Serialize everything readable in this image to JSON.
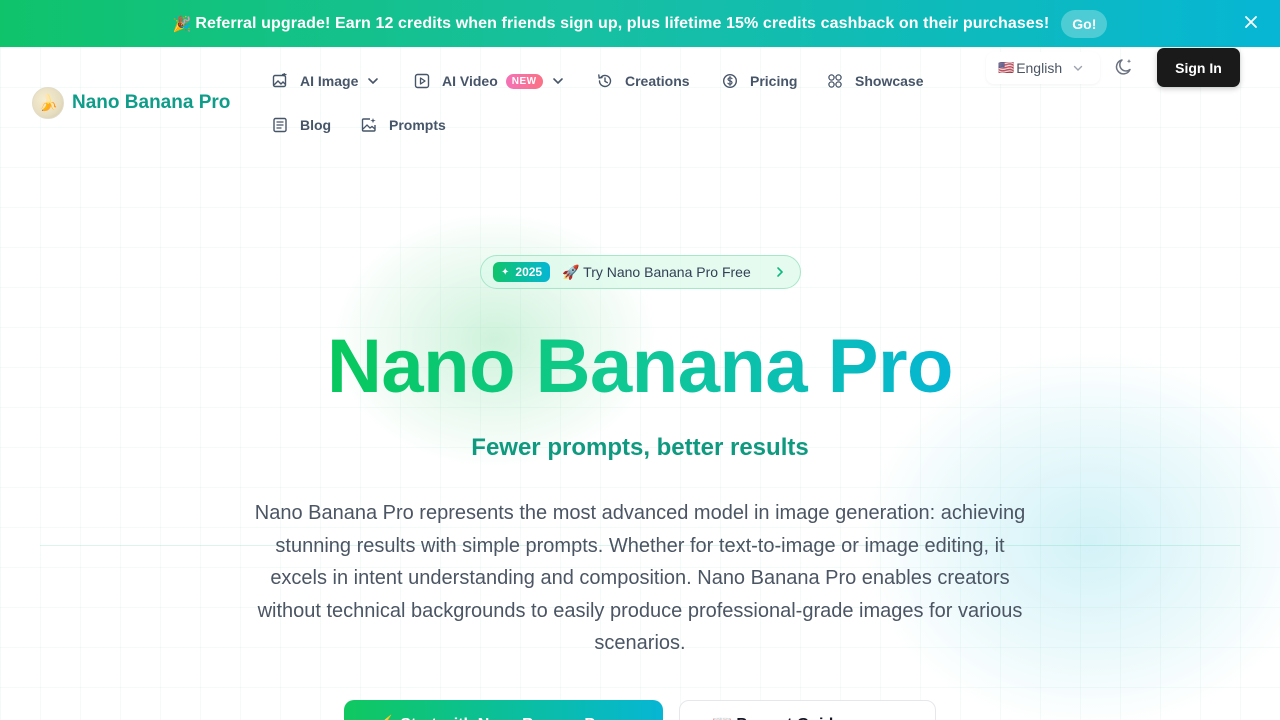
{
  "banner": {
    "emoji": "🎉",
    "text": "Referral upgrade! Earn 12 credits when friends sign up, plus lifetime 15% credits cashback on their purchases!",
    "button": "Go!",
    "close_icon": "close-icon"
  },
  "header": {
    "logo_text": "Nano Banana Pro",
    "logo_emoji": "🍌",
    "nav": [
      {
        "label": "AI Image",
        "icon": "image-edit-icon",
        "dropdown": true
      },
      {
        "label": "AI Video",
        "icon": "video-play-icon",
        "badge": "NEW",
        "dropdown": true
      },
      {
        "label": "Creations",
        "icon": "history-icon"
      },
      {
        "label": "Pricing",
        "icon": "coin-icon"
      },
      {
        "label": "Showcase",
        "icon": "grid-icon"
      },
      {
        "label": "Blog",
        "icon": "document-icon"
      },
      {
        "label": "Prompts",
        "icon": "image-sparkle-icon"
      }
    ],
    "language": {
      "flag": "🇺🇸",
      "label": "English"
    },
    "theme_icon": "moon-icon",
    "sign_in": "Sign In"
  },
  "hero": {
    "pill_tag": "2025",
    "pill_text": "🚀 Try Nano Banana Pro Free",
    "title": "Nano Banana Pro",
    "subtitle": "Fewer prompts, better results",
    "description": "Nano Banana Pro represents the most advanced model in image generation: achieving stunning results with simple prompts. Whether for text-to-image or image editing, it excels in intent understanding and composition. Nano Banana Pro enables creators without technical backgrounds to easily produce professional-grade images for various scenarios.",
    "cta_primary": "⚡ Start with Nano Banana Pro",
    "cta_secondary": "📖 Prompt Guide"
  },
  "colors": {
    "brand_green": "#10c860",
    "brand_cyan": "#06b6d4",
    "brand_teal_text": "#0f9d8a"
  }
}
